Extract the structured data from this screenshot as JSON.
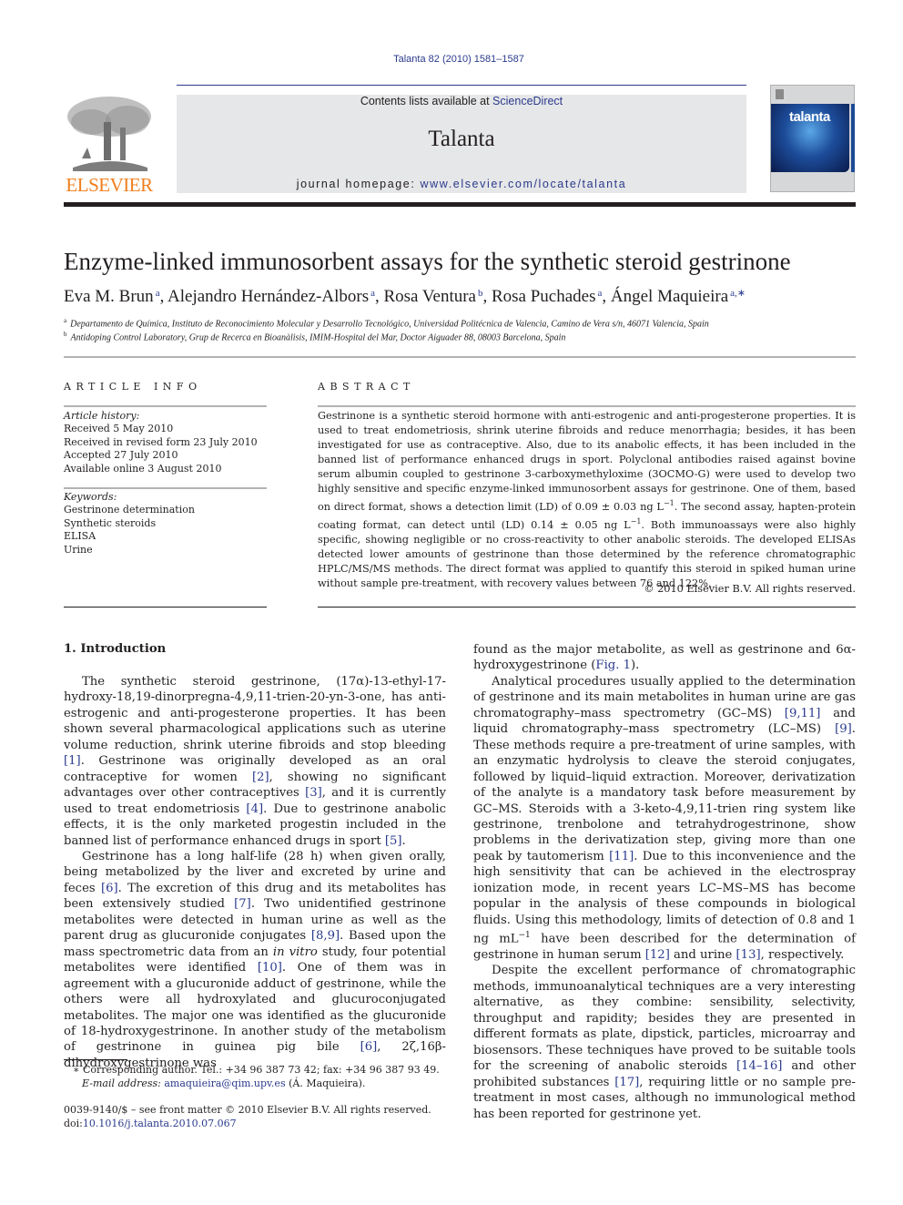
{
  "header": {
    "journal_ref": "Talanta 82 (2010) 1581–1587",
    "contents_prefix": "Contents lists available at ",
    "sciencedirect": "ScienceDirect",
    "journal_name": "Talanta",
    "homepage_prefix": "journal homepage: ",
    "homepage_url": "www.elsevier.com/locate/talanta",
    "publisher_logo": "ELSEVIER",
    "cover_title": "talanta"
  },
  "article": {
    "title": "Enzyme-linked immunosorbent assays for the synthetic steroid gestrinone",
    "authors": [
      {
        "name": "Eva M. Brun",
        "sup": "a",
        "sep": ", "
      },
      {
        "name": "Alejandro Hernández-Albors",
        "sup": "a",
        "sep": ", "
      },
      {
        "name": "Rosa Ventura",
        "sup": "b",
        "sep": ", "
      },
      {
        "name": "Rosa Puchades",
        "sup": "a",
        "sep": ", "
      },
      {
        "name": "Ángel Maquieira",
        "sup": "a,∗",
        "sep": ""
      }
    ],
    "affiliations": [
      {
        "key": "a",
        "text": "Departamento de Química, Instituto de Reconocimiento Molecular y Desarrollo Tecnológico, Universidad Politécnica de Valencia, Camino de Vera s/n, 46071 Valencia, Spain"
      },
      {
        "key": "b",
        "text": "Antidoping Control Laboratory, Grup de Recerca en Bioanàlisis, IMIM-Hospital del Mar, Doctor Aiguader 88, 08003 Barcelona, Spain"
      }
    ]
  },
  "article_info": {
    "label": "ARTICLE INFO",
    "history_label": "Article history:",
    "history": [
      "Received 5 May 2010",
      "Received in revised form 23 July 2010",
      "Accepted 27 July 2010",
      "Available online 3 August 2010"
    ],
    "keywords_label": "Keywords:",
    "keywords": [
      "Gestrinone determination",
      "Synthetic steroids",
      "ELISA",
      "Urine"
    ]
  },
  "abstract": {
    "label": "ABSTRACT",
    "text_1": "Gestrinone is a synthetic steroid hormone with anti-estrogenic and anti-progesterone properties. It is used to treat endometriosis, shrink uterine fibroids and reduce menorrhagia; besides, it has been investigated for use as contraceptive. Also, due to its anabolic effects, it has been included in the banned list of performance enhanced drugs in sport. Polyclonal antibodies raised against bovine serum albumin coupled to gestrinone 3-carboxymethyloxime (3OCMO-G) were used to develop two highly sensitive and specific enzyme-linked immunosorbent assays for gestrinone. One of them, based on direct format, shows a detection limit (LD) of 0.09 ± 0.03 ng L",
    "sup_1": "−1",
    "text_2": ". The second assay, hapten-protein coating format, can detect until (LD) 0.14 ± 0.05 ng L",
    "sup_2": "−1",
    "text_3": ". Both immunoassays were also highly specific, showing negligible or no cross-reactivity to other anabolic steroids. The developed ELISAs detected lower amounts of gestrinone than those determined by the reference chromatographic HPLC/MS/MS methods. The direct format was applied to quantify this steroid in spiked human urine without sample pre-treatment, with recovery values between 76 and 122%.",
    "copyright": "© 2010 Elsevier B.V. All rights reserved."
  },
  "introduction": {
    "heading": "1.  Introduction",
    "p1": [
      {
        "t": "The synthetic steroid gestrinone, (17α)-13-ethyl-17-hydroxy-18,19-dinorpregna-4,9,11-trien-20-yn-3-one, has anti-estrogenic and anti-progesterone properties. It has been shown several pharmacological applications such as uterine volume reduction, shrink uterine fibroids and stop bleeding "
      },
      {
        "ref": "[1]"
      },
      {
        "t": ". Gestrinone was originally developed as an oral contraceptive for women "
      },
      {
        "ref": "[2]"
      },
      {
        "t": ", showing no significant advantages over other contraceptives "
      },
      {
        "ref": "[3]"
      },
      {
        "t": ", and it is currently used to treat endometriosis "
      },
      {
        "ref": "[4]"
      },
      {
        "t": ". Due to gestrinone anabolic effects, it is the only marketed progestin included in the banned list of performance enhanced drugs in sport "
      },
      {
        "ref": "[5]"
      },
      {
        "t": "."
      }
    ],
    "p2": [
      {
        "t": "Gestrinone has a long half-life (28 h) when given orally, being metabolized by the liver and excreted by urine and feces "
      },
      {
        "ref": "[6]"
      },
      {
        "t": ". The excretion of this drug and its metabolites has been extensively studied "
      },
      {
        "ref": "[7]"
      },
      {
        "t": ". Two unidentified gestrinone metabolites were detected in human urine as well as the parent drug as glucuronide conjugates "
      },
      {
        "ref": "[8,9]"
      },
      {
        "t": ". Based upon the mass spectrometric data from an "
      },
      {
        "i": "in vitro"
      },
      {
        "t": " study, four potential metabolites were identified "
      },
      {
        "ref": "[10]"
      },
      {
        "t": ". One of them was in agreement with a glucuronide adduct of gestrinone, while the others were all hydroxylated and glucuroconjugated metabolites. The major one was identified as the glucuronide of 18-hydroxygestrinone. In another study of the metabolism of gestrinone in guinea pig bile "
      },
      {
        "ref": "[6]"
      },
      {
        "t": ", 2ζ,16β-dihydroxygestrinone was found as the major metabolite, as well as gestrinone and 6α-hydroxygestrinone ("
      },
      {
        "ref": "Fig. 1"
      },
      {
        "t": ")."
      }
    ],
    "p3": [
      {
        "t": "Analytical procedures usually applied to the determination of gestrinone and its main metabolites in human urine are gas chromatography–mass spectrometry (GC–MS) "
      },
      {
        "ref": "[9,11]"
      },
      {
        "t": " and liquid chromatography–mass spectrometry (LC–MS) "
      },
      {
        "ref": "[9]"
      },
      {
        "t": ". These methods require a pre-treatment of urine samples, with an enzymatic hydrolysis to cleave the steroid conjugates, followed by liquid–liquid extraction. Moreover, derivatization of the analyte is a mandatory task before measurement by GC–MS. Steroids with a 3-keto-4,9,11-trien ring system like gestrinone, trenbolone and tetrahydrogestrinone, show problems in the derivatization step, giving more than one peak by tautomerism "
      },
      {
        "ref": "[11]"
      },
      {
        "t": ". Due to this inconvenience and the high sensitivity that can be achieved in the electrospray ionization mode, in recent years LC–MS–MS has become popular in the analysis of these compounds in biological fluids. Using this methodology, limits of detection of 0.8 and 1 ng mL"
      },
      {
        "sup": "−1"
      },
      {
        "t": " have been described for the determination of gestrinone in human serum "
      },
      {
        "ref": "[12]"
      },
      {
        "t": " and urine "
      },
      {
        "ref": "[13]"
      },
      {
        "t": ", respectively."
      }
    ],
    "p4": [
      {
        "t": "Despite the excellent performance of chromatographic methods, immunoanalytical techniques are a very interesting alternative, as they combine: sensibility, selectivity, throughput and rapidity; besides they are presented in different formats as plate, dipstick, particles, microarray and biosensors. These techniques have proved to be suitable tools for the screening of anabolic steroids "
      },
      {
        "ref": "[14–16]"
      },
      {
        "t": " and other prohibited substances "
      },
      {
        "ref": "[17]"
      },
      {
        "t": ", requiring little or no sample pre-treatment in most cases, although no immunological method has been reported for gestrinone yet."
      }
    ]
  },
  "footnotes": {
    "corresponding": "∗ Corresponding author. Tel.: +34 96 387 73 42; fax: +34 96 387 93 49.",
    "email_label": "E-mail address: ",
    "email": "amaquieira@qim.upv.es",
    "email_suffix": " (Á. Maquieira).",
    "issn": "0039-9140/$ – see front matter © 2010 Elsevier B.V. All rights reserved.",
    "doi_prefix": "doi:",
    "doi": "10.1016/j.talanta.2010.07.067"
  },
  "colors": {
    "link": "#2a3a8c",
    "elsevier_orange": "#f07f1d",
    "masthead_bg": "#e6e7e8"
  }
}
